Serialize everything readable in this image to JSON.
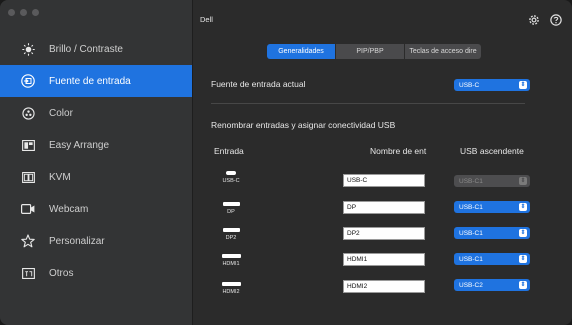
{
  "window": {
    "title": "Dell",
    "traffic_colors": [
      "#ff5f57",
      "#febc2e",
      "#28c840"
    ]
  },
  "sidebar": {
    "items": [
      {
        "label": "Brillo / Contraste",
        "icon": "brightness-icon",
        "active": false
      },
      {
        "label": "Fuente de entrada",
        "icon": "input-source-icon",
        "active": true
      },
      {
        "label": "Color",
        "icon": "color-icon",
        "active": false
      },
      {
        "label": "Easy Arrange",
        "icon": "easy-arrange-icon",
        "active": false
      },
      {
        "label": "KVM",
        "icon": "kvm-icon",
        "active": false
      },
      {
        "label": "Webcam",
        "icon": "webcam-icon",
        "active": false
      },
      {
        "label": "Personalizar",
        "icon": "star-icon",
        "active": false
      },
      {
        "label": "Otros",
        "icon": "others-icon",
        "active": false
      }
    ]
  },
  "header": {
    "icons": [
      "settings-icon",
      "help-icon"
    ]
  },
  "tabs": [
    {
      "label": "Generalidades",
      "active": true
    },
    {
      "label": "PIP/PBP",
      "active": false
    },
    {
      "label": "Teclas de acceso dire",
      "active": false
    }
  ],
  "current_input": {
    "label": "Fuente de entrada actual",
    "value": "USB-C"
  },
  "rename_section": {
    "title": "Renombrar entradas y asignar conectividad USB",
    "columns": [
      "Entrada",
      "Nombre de entı",
      "USB ascendente"
    ],
    "rows": [
      {
        "port": "USB-C",
        "name": "USB-C",
        "usb": "USB-C1",
        "disabled": true
      },
      {
        "port": "DP",
        "name": "DP",
        "usb": "USB-C1",
        "disabled": false
      },
      {
        "port": "DP2",
        "name": "DP2",
        "usb": "USB-C1",
        "disabled": false
      },
      {
        "port": "HDMI1",
        "name": "HDMI1",
        "usb": "USB-C1",
        "disabled": false
      },
      {
        "port": "HDMI2",
        "name": "HDMI2",
        "usb": "USB-C2",
        "disabled": false
      }
    ]
  },
  "colors": {
    "accent": "#1f73e0",
    "sidebar_bg": "#333435",
    "main_bg": "#2b2b2b"
  }
}
